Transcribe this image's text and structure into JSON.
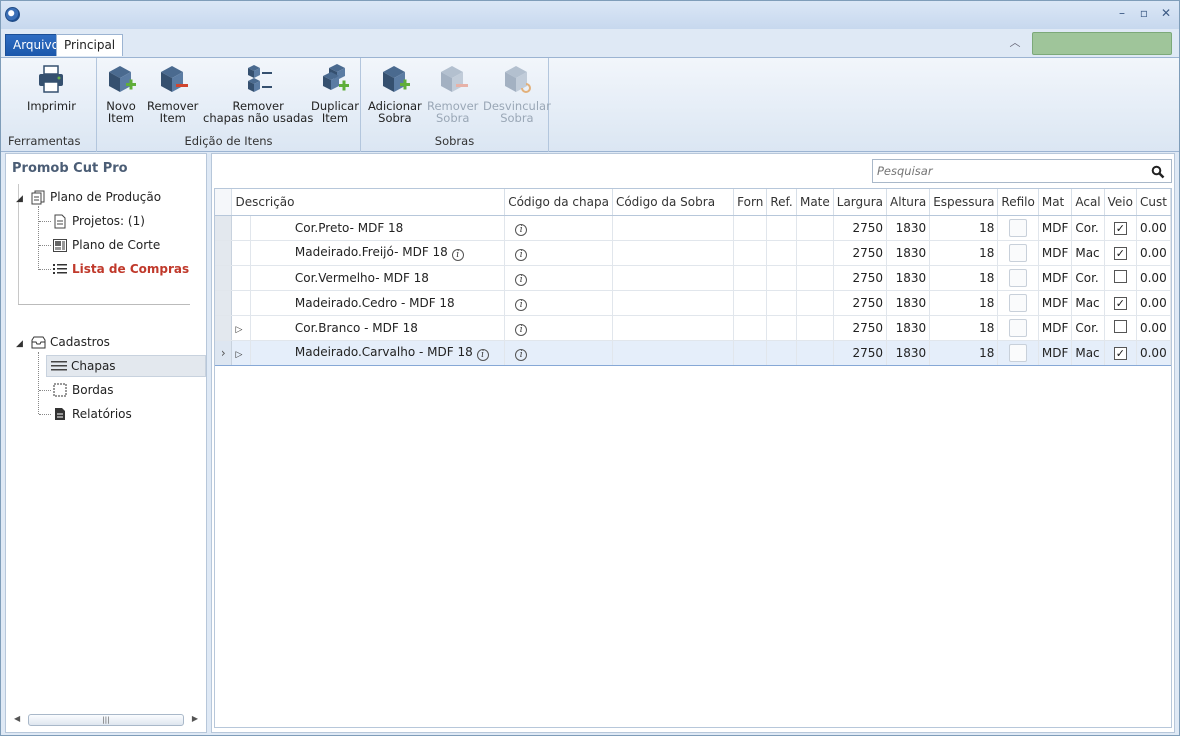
{
  "window": {
    "controls": [
      "–",
      "▫",
      "✕"
    ]
  },
  "tabs": [
    {
      "label": "Arquivo",
      "active": true
    },
    {
      "label": "Principal",
      "active": false
    }
  ],
  "ribbon": {
    "groups": [
      {
        "label": "Ferramentas",
        "buttons": [
          {
            "line1": "Imprimir",
            "line2": "",
            "enabled": true
          }
        ]
      },
      {
        "label": "Edição de Itens",
        "buttons": [
          {
            "line1": "Novo",
            "line2": "Item",
            "enabled": true
          },
          {
            "line1": "Remover",
            "line2": "Item",
            "enabled": true
          },
          {
            "line1": "Remover",
            "line2": "chapas não usadas",
            "enabled": true
          },
          {
            "line1": "Duplicar",
            "line2": "Item",
            "enabled": true
          }
        ]
      },
      {
        "label": "Sobras",
        "buttons": [
          {
            "line1": "Adicionar",
            "line2": "Sobra",
            "enabled": true
          },
          {
            "line1": "Remover",
            "line2": "Sobra",
            "enabled": false
          },
          {
            "line1": "Desvincular",
            "line2": "Sobra",
            "enabled": false
          }
        ]
      }
    ]
  },
  "nav": {
    "title": "Promob Cut Pro",
    "plano": "Plano de Produção",
    "projetos": "Projetos: (1)",
    "plano_corte": "Plano de Corte",
    "lista_compras": "Lista de Compras",
    "cadastros": "Cadastros",
    "chapas": "Chapas",
    "bordas": "Bordas",
    "relatorios": "Relatórios"
  },
  "search": {
    "placeholder": "Pesquisar"
  },
  "grid": {
    "columns": [
      "Descrição",
      "Código da chapa",
      "Código da Sobra",
      "Forn",
      "Ref.",
      "Mate",
      "Largura",
      "Altura",
      "Espessura",
      "Refilo",
      "Mat",
      "Acal",
      "Veio",
      "Cust"
    ],
    "rows": [
      {
        "descricao": "Cor.Preto- MDF 18",
        "info": false,
        "expandable": false,
        "largura": "2750",
        "altura": "1830",
        "espessura": "18",
        "mat": "MDF",
        "acab": "Cor.",
        "veio": true,
        "custo": "0.00",
        "selected": false
      },
      {
        "descricao": "Madeirado.Freijó- MDF 18",
        "info": true,
        "expandable": false,
        "largura": "2750",
        "altura": "1830",
        "espessura": "18",
        "mat": "MDF",
        "acab": "Mac",
        "veio": true,
        "custo": "0.00",
        "selected": false
      },
      {
        "descricao": "Cor.Vermelho- MDF 18",
        "info": false,
        "expandable": false,
        "largura": "2750",
        "altura": "1830",
        "espessura": "18",
        "mat": "MDF",
        "acab": "Cor.",
        "veio": false,
        "custo": "0.00",
        "selected": false
      },
      {
        "descricao": "Madeirado.Cedro - MDF 18",
        "info": false,
        "expandable": false,
        "largura": "2750",
        "altura": "1830",
        "espessura": "18",
        "mat": "MDF",
        "acab": "Mac",
        "veio": true,
        "custo": "0.00",
        "selected": false
      },
      {
        "descricao": "Cor.Branco - MDF 18",
        "info": false,
        "expandable": true,
        "largura": "2750",
        "altura": "1830",
        "espessura": "18",
        "mat": "MDF",
        "acab": "Cor.",
        "veio": false,
        "custo": "0.00",
        "selected": false
      },
      {
        "descricao": "Madeirado.Carvalho - MDF 18",
        "info": true,
        "expandable": true,
        "largura": "2750",
        "altura": "1830",
        "espessura": "18",
        "mat": "MDF",
        "acab": "Mac",
        "veio": true,
        "custo": "0.00",
        "selected": true
      }
    ]
  },
  "colors": {
    "accent": "#1b57ab",
    "active_nav": "#c0392b"
  }
}
